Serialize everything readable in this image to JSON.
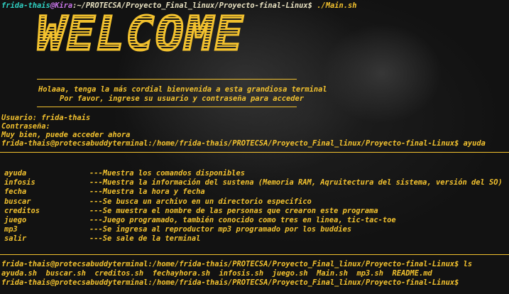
{
  "prompt1": {
    "user": "frida-thais",
    "host": "Kira",
    "path": ":~/PROTECSA/Proyecto_Final_linux/Proyecto-final-Linux$",
    "command": "./Main.sh"
  },
  "welcome": "WELCOME",
  "banner": {
    "line1": "Holaaa, tenga la más cordial bienvenida a esta grandiosa terminal",
    "line2": "Por favor, ingrese su usuario y contraseña para acceder"
  },
  "login": {
    "user_line": "Usuario: frida-thais",
    "pass_line": "Contraseña:",
    "ok_line": "Muy bien, puede acceder ahora"
  },
  "prompt2": {
    "text": "frida-thais@protecsabuddyterminal:/home/frida-thais/PROTECSA/Proyecto_Final_linux/Proyecto-final-Linux$",
    "command": "ayuda"
  },
  "commands": [
    {
      "name": "ayuda",
      "desc": "---Muestra los comandos disponibles"
    },
    {
      "name": "infosis",
      "desc": "---Muestra la información del sustena (Memoria RAM, Aqruitectura del sistema, versión del SO)"
    },
    {
      "name": "fecha",
      "desc": "---Muestra la hora y fecha"
    },
    {
      "name": "buscar",
      "desc": "---Se busca un archivo en un directorio especifico"
    },
    {
      "name": "creditos",
      "desc": "---Se muestra el nombre de las personas que crearon este programa"
    },
    {
      "name": "juego",
      "desc": "---Juego programado, también conocido como tres en linea, tic-tac-toe"
    },
    {
      "name": "mp3",
      "desc": "---Se ingresa al reproductor mp3 programado por los buddies"
    },
    {
      "name": "salir",
      "desc": "---Se sale de la terminal"
    }
  ],
  "prompt3": {
    "text": "frida-thais@protecsabuddyterminal:/home/frida-thais/PROTECSA/Proyecto_Final_linux/Proyecto-final-Linux$",
    "command": "ls"
  },
  "ls_output": "ayuda.sh  buscar.sh  creditos.sh  fechayhora.sh  infosis.sh  juego.sh  Main.sh  mp3.sh  README.md",
  "prompt4": {
    "text": "frida-thais@protecsabuddyterminal:/home/frida-thais/PROTECSA/Proyecto_Final_linux/Proyecto-final-Linux$"
  }
}
